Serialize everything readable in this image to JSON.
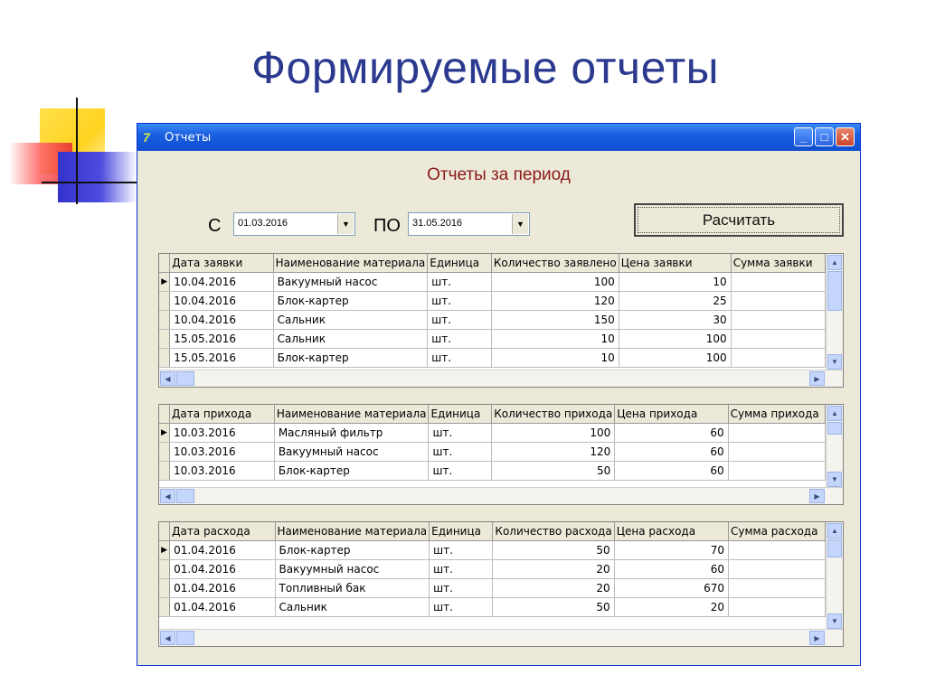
{
  "slide": {
    "title": "Формируемые отчеты"
  },
  "window": {
    "title": "Отчеты",
    "heading": "Отчеты за период",
    "from_label": "С",
    "to_label": "ПО",
    "date_from": "01.03.2016",
    "date_to": "31.05.2016",
    "calculate_label": "Расчитать"
  },
  "requests": {
    "columns": [
      "Дата заявки",
      "Наименование материала",
      "Единица",
      "Количество заявлено",
      "Цена заявки",
      "Сумма заявки"
    ],
    "rows": [
      [
        "10.04.2016",
        "Вакуумный насос",
        "шт.",
        "100",
        "10",
        ""
      ],
      [
        "10.04.2016",
        "Блок-картер",
        "шт.",
        "120",
        "25",
        ""
      ],
      [
        "10.04.2016",
        "Сальник",
        "шт.",
        "150",
        "30",
        ""
      ],
      [
        "15.05.2016",
        "Сальник",
        "шт.",
        "10",
        "100",
        ""
      ],
      [
        "15.05.2016",
        "Блок-картер",
        "шт.",
        "10",
        "100",
        ""
      ]
    ]
  },
  "incoming": {
    "columns": [
      "Дата прихода",
      "Наименование материала",
      "Единица",
      "Количество прихода",
      "Цена прихода",
      "Сумма прихода"
    ],
    "rows": [
      [
        "10.03.2016",
        "Масляный фильтр",
        "шт.",
        "100",
        "60",
        ""
      ],
      [
        "10.03.2016",
        "Вакуумный насос",
        "шт.",
        "120",
        "60",
        ""
      ],
      [
        "10.03.2016",
        "Блок-картер",
        "шт.",
        "50",
        "60",
        ""
      ]
    ]
  },
  "outgoing": {
    "columns": [
      "Дата расхода",
      "Наименование материала",
      "Единица",
      "Количество расхода",
      "Цена расхода",
      "Сумма расхода"
    ],
    "rows": [
      [
        "01.04.2016",
        "Блок-картер",
        "шт.",
        "50",
        "70",
        ""
      ],
      [
        "01.04.2016",
        "Вакуумный насос",
        "шт.",
        "20",
        "60",
        ""
      ],
      [
        "01.04.2016",
        "Топливный бак",
        "шт.",
        "20",
        "670",
        ""
      ],
      [
        "01.04.2016",
        "Сальник",
        "шт.",
        "50",
        "20",
        ""
      ]
    ]
  }
}
